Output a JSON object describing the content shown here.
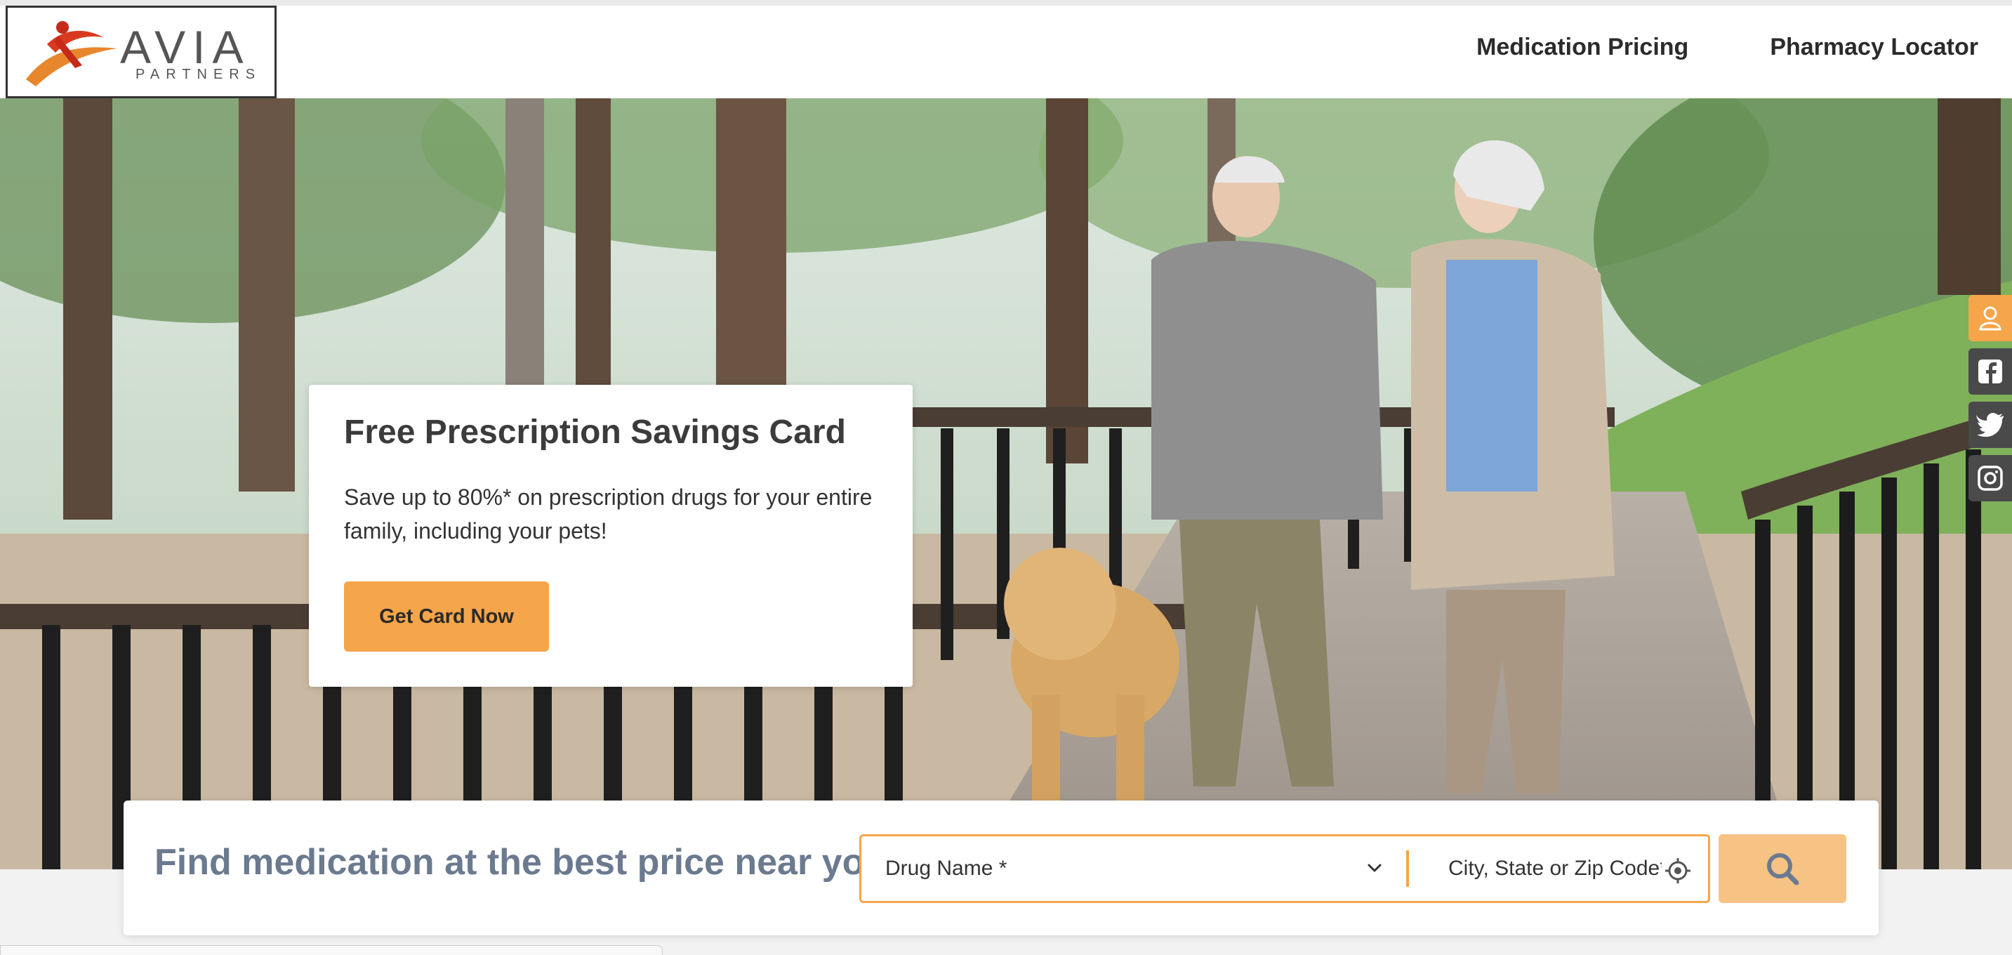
{
  "header": {
    "logo": {
      "word": "AVIA",
      "sub": "PARTNERS",
      "mark_icon": "avia-figure-logo"
    },
    "nav": [
      {
        "label": "Medication Pricing"
      },
      {
        "label": "Pharmacy Locator"
      }
    ]
  },
  "hero": {
    "card": {
      "title": "Free Prescription Savings Card",
      "text": "Save up to 80%* on prescription drugs for your entire family, including your pets!",
      "button": "Get Card Now"
    }
  },
  "social": [
    {
      "icon": "user-icon"
    },
    {
      "icon": "facebook-icon"
    },
    {
      "icon": "twitter-icon"
    },
    {
      "icon": "instagram-icon"
    }
  ],
  "search": {
    "title": "Find medication at the best price near you:",
    "drug_placeholder": "Drug Name *",
    "location_placeholder": "City, State or Zip Code*",
    "search_icon": "search-icon"
  },
  "colors": {
    "accent": "#f5a54a",
    "accent_light": "#f7c384",
    "title_blue_gray": "#6b7a8f",
    "dark_text": "#3b3b3b"
  }
}
